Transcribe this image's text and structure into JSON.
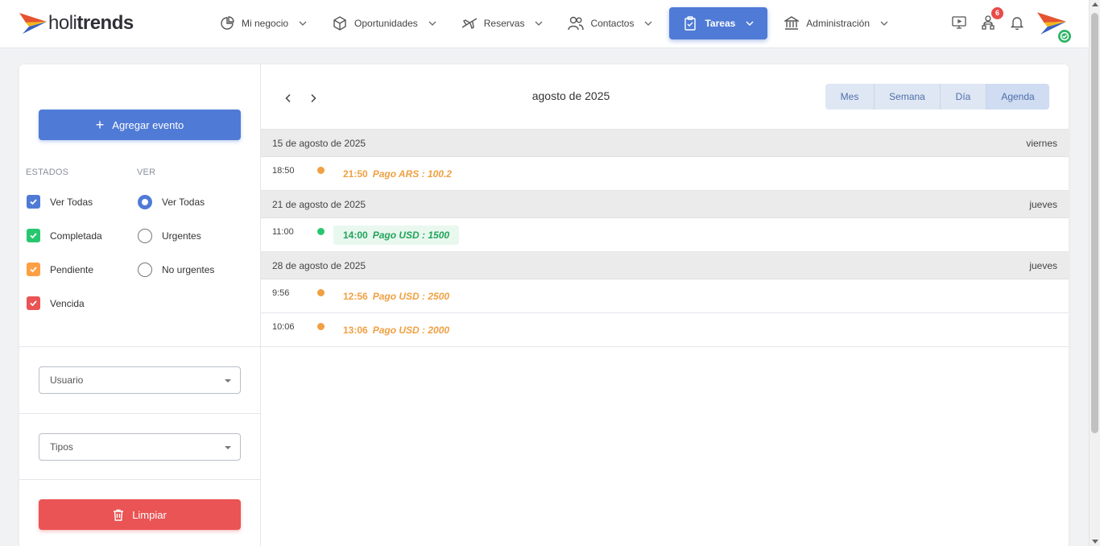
{
  "app": {
    "logo_text_light": "holi",
    "logo_text_bold": "trends"
  },
  "nav": {
    "items": [
      {
        "label": "Mi negocio",
        "icon": "pie-chart-icon"
      },
      {
        "label": "Oportunidades",
        "icon": "box-icon"
      },
      {
        "label": "Reservas",
        "icon": "plane-icon"
      },
      {
        "label": "Contactos",
        "icon": "users-icon"
      },
      {
        "label": "Tareas",
        "icon": "clipboard-check-icon",
        "active": true
      },
      {
        "label": "Administración",
        "icon": "bank-icon"
      }
    ],
    "notifications_badge": "6"
  },
  "sidebar": {
    "add_event_label": "Agregar evento",
    "estados_title": "ESTADOS",
    "ver_title": "VER",
    "estados": [
      {
        "label": "Ver Todas",
        "color": "#4f7bd6",
        "checked": true
      },
      {
        "label": "Completada",
        "color": "#28c76f",
        "checked": true
      },
      {
        "label": "Pendiente",
        "color": "#ff9f43",
        "checked": true
      },
      {
        "label": "Vencida",
        "color": "#ea5455",
        "checked": true
      }
    ],
    "ver": [
      {
        "label": "Ver Todas",
        "selected": true
      },
      {
        "label": "Urgentes",
        "selected": false
      },
      {
        "label": "No urgentes",
        "selected": false
      }
    ],
    "usuario_placeholder": "Usuario",
    "tipos_placeholder": "Tipos",
    "clear_label": "Limpiar"
  },
  "calendar": {
    "title": "agosto de 2025",
    "views": [
      {
        "label": "Mes",
        "active": false
      },
      {
        "label": "Semana",
        "active": false
      },
      {
        "label": "Día",
        "active": false
      },
      {
        "label": "Agenda",
        "active": true
      }
    ],
    "days": [
      {
        "date": "15 de agosto de 2025",
        "weekday": "viernes",
        "events": [
          {
            "time": "18:50",
            "end": "21:50",
            "title": "Pago ARS : 100.2",
            "status": "pendiente"
          }
        ]
      },
      {
        "date": "21 de agosto de 2025",
        "weekday": "jueves",
        "events": [
          {
            "time": "11:00",
            "end": "14:00",
            "title": "Pago USD : 1500",
            "status": "completada"
          }
        ]
      },
      {
        "date": "28 de agosto de 2025",
        "weekday": "jueves",
        "events": [
          {
            "time": "9:56",
            "end": "12:56",
            "title": "Pago USD : 2500",
            "status": "pendiente"
          },
          {
            "time": "10:06",
            "end": "13:06",
            "title": "Pago USD : 2000",
            "status": "pendiente"
          }
        ]
      }
    ]
  },
  "colors": {
    "primary": "#4f7bd6",
    "pendiente": "#f0a042",
    "completada": "#28c76f",
    "completada_text": "#22a35a",
    "completada_bg": "#e9f8ef",
    "danger": "#ea5455"
  }
}
